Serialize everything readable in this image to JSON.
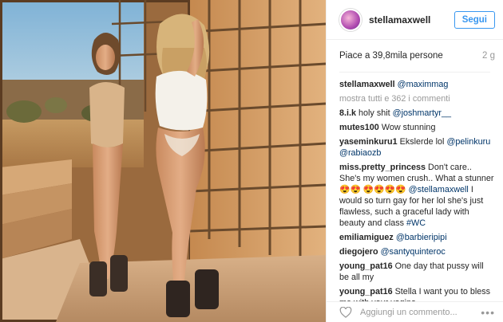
{
  "post": {
    "username": "stellamaxwell",
    "follow_label": "Segui",
    "likes_text": "Piace a 39,8mila persone",
    "age": "2 g",
    "comment_placeholder": "Aggiungi un commento...",
    "more_icon": "ellipsis-icon",
    "like_icon": "heart-outline-icon",
    "accent_color": "#3897f0",
    "mention_color": "#003569"
  },
  "caption": {
    "user": "stellamaxwell",
    "mention": "@maximmag"
  },
  "view_all": "mostra tutti e 362 i commenti",
  "comments": [
    {
      "user": "8.i.k",
      "text": "holy shit",
      "mention": "@joshmartyr__"
    },
    {
      "user": "mutes100",
      "text": "Wow stunning"
    },
    {
      "user": "yaseminkuru1",
      "text": "Ekslerde lol",
      "mention": "@pelinkuru",
      "mention2": "@rabiaozb"
    },
    {
      "user": "miss.pretty_princess",
      "text": "Don't care.. She's my women crush.. What a stunner 😍😍 😍😍😍😍",
      "mention": "@stellamaxwell",
      "text2": "I would so turn gay for her lol she's just flawless, such a graceful lady with beauty and class",
      "tag": "#WC"
    },
    {
      "user": "emiliamiguez",
      "mention": "@barbieripipi"
    },
    {
      "user": "diegojero",
      "mention": "@santyquinteroc"
    },
    {
      "user": "young_pat16",
      "text": "One day that pussy will be all my"
    },
    {
      "user": "young_pat16",
      "text": "Stella I want you to bless me with your vagina"
    }
  ]
}
